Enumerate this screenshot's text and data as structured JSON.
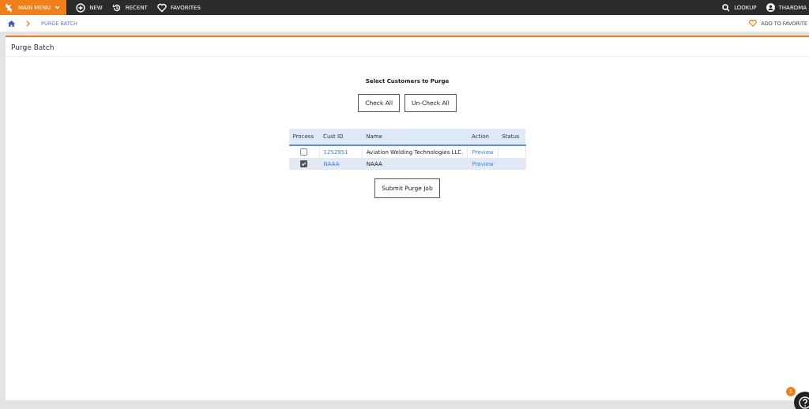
{
  "topbar": {
    "main_menu": "MAIN MENU",
    "items": [
      {
        "kind": "new",
        "label": "NEW"
      },
      {
        "kind": "recent",
        "label": "RECENT"
      },
      {
        "kind": "favorites",
        "label": "FAVORITES"
      }
    ],
    "lookup": "LOOKUP",
    "user": "THARDMA"
  },
  "breadcrumb": {
    "current": "PURGE BATCH",
    "add_favorite": "ADD TO FAVORITE"
  },
  "panel": {
    "title": "Purge Batch",
    "heading": "Select Customers to Purge",
    "buttons": [
      "Check All",
      "Un-Check All"
    ],
    "table": {
      "columns": [
        "Process",
        "Cust ID",
        "Name",
        "Action",
        "Status"
      ],
      "rows": [
        {
          "checked": false,
          "cust_id": "1252951",
          "name": "Aviation Welding Technologies LLC.",
          "action": "Preview"
        },
        {
          "checked": true,
          "cust_id": "NAAA",
          "name": "NAAA",
          "action": "Preview"
        }
      ]
    },
    "submit": "Submit Purge Job"
  },
  "help": {
    "badge": "1"
  }
}
